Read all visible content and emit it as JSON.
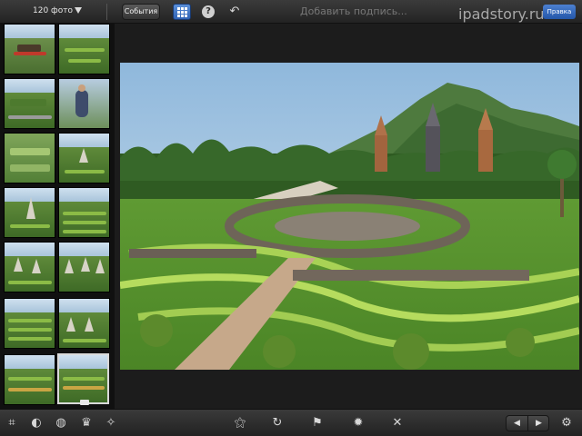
{
  "topbar": {
    "photo_count": "120 фото",
    "events_label": "События",
    "caption_placeholder": "Добавить подпись...",
    "edit_label": "Правка",
    "watermark": "ipadstory.ru"
  },
  "icons": {
    "dropdown": "chevron-down-icon",
    "grid": "grid-icon",
    "help": "help-icon",
    "undo": "undo-icon",
    "share": "share-icon",
    "crop": "crop-icon",
    "auto_enhance": "enhance-icon",
    "color": "palette-icon",
    "brushes": "brush-icon",
    "effects": "effects-icon",
    "magic_wand": "magic-wand-icon",
    "rotate": "rotate-icon",
    "flag": "flag-icon",
    "favorite": "favorite-icon",
    "hide": "close-icon",
    "previous": "arrow-left-icon",
    "next": "arrow-right-icon",
    "settings": "gear-icon"
  },
  "colors": {
    "accent": "#2f62b5",
    "bar": "#2a2a2a",
    "background": "#1c1c1c"
  }
}
